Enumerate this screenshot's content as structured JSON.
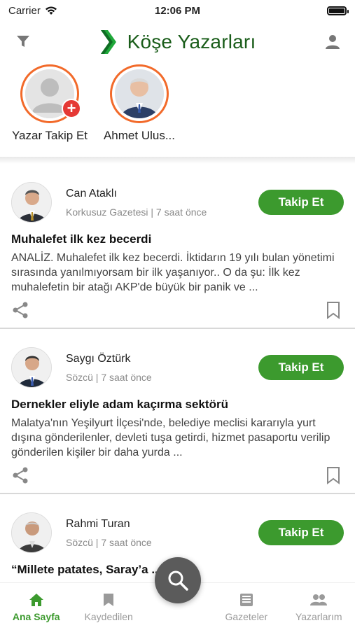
{
  "status_bar": {
    "carrier": "Carrier",
    "time": "12:06 PM"
  },
  "header": {
    "title": "Köşe Yazarları"
  },
  "authors": [
    {
      "name": "Yazar Takip Et"
    },
    {
      "name": "Ahmet Ulus..."
    }
  ],
  "articles": [
    {
      "author": "Can Ataklı",
      "source": "Korkusuz Gazetesi | 7 saat önce",
      "follow_label": "Takip Et",
      "title": "Muhalefet ilk kez becerdi",
      "excerpt": "ANALİZ. Muhalefet ilk kez becerdi. İktidarın 19 yılı bulan yönetimi sırasında yanılmıyorsam bir ilk yaşanıyor.. O da şu: İlk kez muhalefetin bir atağı AKP'de büyük bir panik ve ..."
    },
    {
      "author": "Saygı Öztürk",
      "source": "Sözcü | 7 saat önce",
      "follow_label": "Takip Et",
      "title": "Dernekler eliyle adam kaçırma sektörü",
      "excerpt": "Malatya'nın Yeşilyurt İlçesi'nde, belediye meclisi kararıyla yurt dışına gönderilenler, devleti tuşa getirdi, hizmet pasaportu verilip gönderilen kişiler bir daha yurda ..."
    },
    {
      "author": "Rahmi Turan",
      "source": "Sözcü | 7 saat önce",
      "follow_label": "Takip Et",
      "title": "“Millete patates, Saray’a ... des!”",
      "excerpt": ""
    }
  ],
  "tabbar": {
    "tabs": [
      {
        "label": "Ana Sayfa",
        "icon": "home-icon"
      },
      {
        "label": "Kaydedilen",
        "icon": "bookmark-icon"
      },
      {
        "label": "Gazeteler",
        "icon": "newspaper-icon"
      },
      {
        "label": "Yazarlarım",
        "icon": "people-icon"
      }
    ]
  },
  "colors": {
    "accent_green": "#3c9a2e",
    "title_green": "#1a5d1a",
    "ring_orange": "#f26a2a",
    "badge_red": "#e53935"
  }
}
